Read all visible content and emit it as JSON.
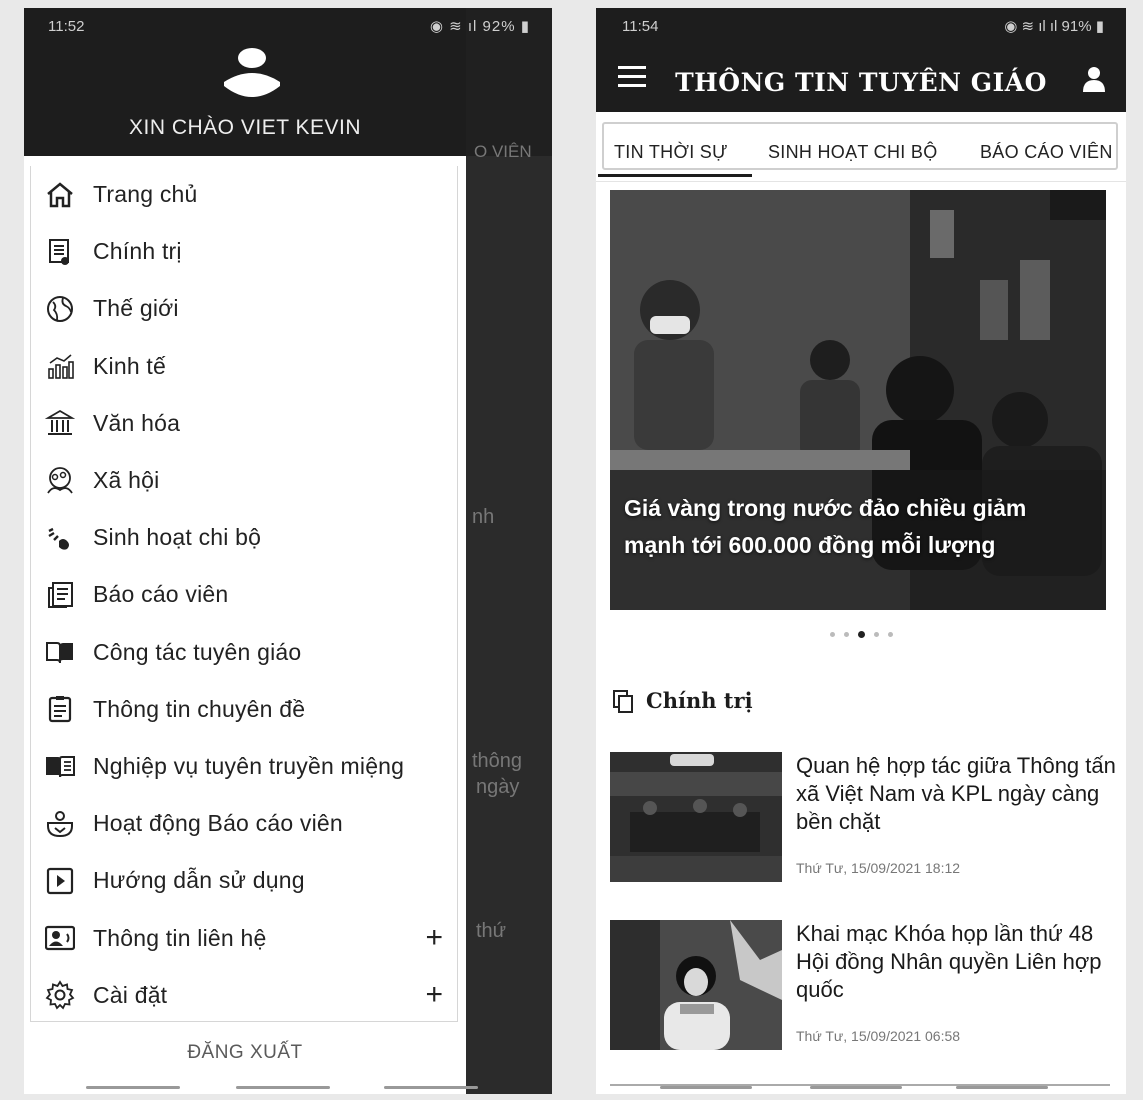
{
  "left_screen": {
    "status_bar": {
      "time": "11:52",
      "indicators": "92%"
    },
    "greeting": "XIN CHÀO VIET KEVIN",
    "behind": {
      "tab_fragment": "O VIÊN",
      "text_a": "nh",
      "text_b": "thông",
      "text_c": "ngày",
      "text_d": "thứ"
    },
    "menu_items": [
      {
        "label": "Trang chủ",
        "icon": "home-icon",
        "expandable": false
      },
      {
        "label": "Chính trị",
        "icon": "document-icon",
        "expandable": false
      },
      {
        "label": "Thế giới",
        "icon": "globe-icon",
        "expandable": false
      },
      {
        "label": "Kinh tế",
        "icon": "chart-icon",
        "expandable": false
      },
      {
        "label": "Văn hóa",
        "icon": "museum-icon",
        "expandable": false
      },
      {
        "label": "Xã hội",
        "icon": "people-icon",
        "expandable": false
      },
      {
        "label": "Sinh hoạt chi bộ",
        "icon": "signal-icon",
        "expandable": false
      },
      {
        "label": "Báo cáo viên",
        "icon": "newspaper-icon",
        "expandable": false
      },
      {
        "label": "Công tác tuyên giáo",
        "icon": "open-book-icon",
        "expandable": false
      },
      {
        "label": "Thông tin chuyên đề",
        "icon": "clipboard-icon",
        "expandable": false
      },
      {
        "label": "Nghiệp vụ tuyên truyền miệng",
        "icon": "book-icon",
        "expandable": false
      },
      {
        "label": "Hoạt động Báo cáo viên",
        "icon": "speaker-icon",
        "expandable": false
      },
      {
        "label": "Hướng dẫn sử dụng",
        "icon": "play-icon",
        "expandable": false
      },
      {
        "label": "Thông tin liên hệ",
        "icon": "contact-card-icon",
        "expandable": true,
        "expand_symbol": "+"
      },
      {
        "label": "Cài đặt",
        "icon": "gear-icon",
        "expandable": true,
        "expand_symbol": "+"
      }
    ],
    "logout_label": "ĐĂNG XUẤT"
  },
  "right_screen": {
    "status_bar": {
      "time": "11:54",
      "indicators": "91%"
    },
    "app_title": "THÔNG TIN TUYÊN GIÁO",
    "tabs": [
      {
        "label": "TIN THỜI SỰ",
        "active": true
      },
      {
        "label": "SINH HOẠT CHI BỘ",
        "active": false
      },
      {
        "label": "BÁO CÁO VIÊN",
        "active": false
      }
    ],
    "hero": {
      "caption": "Giá vàng trong nước đảo chiều giảm mạnh tới 600.000 đồng mỗi lượng",
      "slide_count": 5,
      "active_slide": 3
    },
    "section_title": "Chính trị",
    "articles": [
      {
        "title": "Quan hệ hợp tác giữa Thông tấn xã Việt Nam và KPL ngày càng bền chặt",
        "time": "Thứ Tư, 15/09/2021 18:12"
      },
      {
        "title": "Khai mạc Khóa họp lần thứ 48 Hội đồng Nhân quyền Liên hợp quốc",
        "time": "Thứ Tư, 15/09/2021 06:58"
      }
    ]
  },
  "colors": {
    "header_dark": "#1d1d1d",
    "overlay_dark": "#2b2b2b",
    "text": "#222222",
    "muted": "#777777"
  }
}
